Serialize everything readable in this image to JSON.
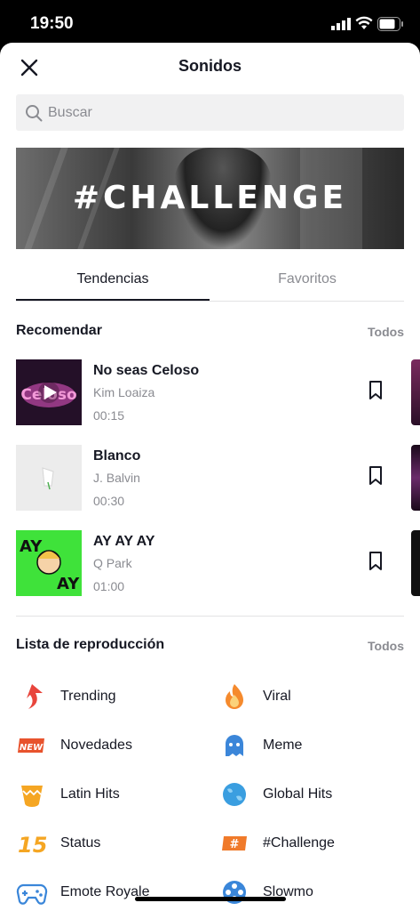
{
  "status_bar": {
    "time": "19:50"
  },
  "header": {
    "title": "Sonidos"
  },
  "search": {
    "placeholder": "Buscar"
  },
  "banner": {
    "text": "#CHALLENGE"
  },
  "tabs": [
    {
      "label": "Tendencias",
      "active": true
    },
    {
      "label": "Favoritos",
      "active": false
    }
  ],
  "recommend": {
    "title": "Recomendar",
    "all_label": "Todos",
    "tracks": [
      {
        "name": "No seas Celoso",
        "artist": "Kim Loaiza",
        "duration": "00:15",
        "cover_color": "#2a1430"
      },
      {
        "name": "Blanco",
        "artist": "J. Balvin",
        "duration": "00:30",
        "cover_color": "#ededed"
      },
      {
        "name": "AY AY AY",
        "artist": "Q Park",
        "duration": "01:00",
        "cover_color": "#3ddc3a"
      }
    ]
  },
  "playlists": {
    "title": "Lista de reproducción",
    "all_label": "Todos",
    "items": [
      {
        "label": "Trending",
        "icon": "trending-arrow-icon",
        "color": "#e8453c"
      },
      {
        "label": "Viral",
        "icon": "flame-icon",
        "color": "#f58a2d"
      },
      {
        "label": "Novedades",
        "icon": "new-badge-icon",
        "color": "#e8532d"
      },
      {
        "label": "Meme",
        "icon": "ghost-icon",
        "color": "#3b86d9"
      },
      {
        "label": "Latin Hits",
        "icon": "maraca-icon",
        "color": "#f5a623"
      },
      {
        "label": "Global Hits",
        "icon": "globe-icon",
        "color": "#3a9ee0"
      },
      {
        "label": "Status",
        "icon": "fifteen-icon",
        "color": "#f5a623"
      },
      {
        "label": "#Challenge",
        "icon": "hashtag-badge-icon",
        "color": "#f07a2a"
      },
      {
        "label": "Emote Royale",
        "icon": "gamepad-icon",
        "color": "#3a86d9"
      },
      {
        "label": "Slowmo",
        "icon": "film-reel-icon",
        "color": "#3a86d9"
      }
    ]
  }
}
